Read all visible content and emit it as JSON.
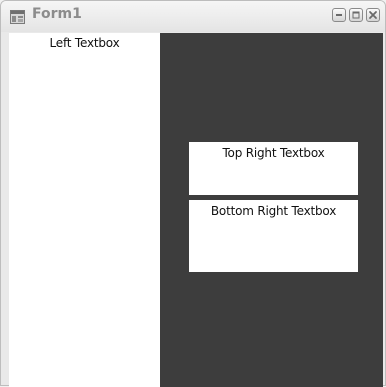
{
  "window": {
    "title": "Form1",
    "icon": "windows-form-icon",
    "controls": [
      "minimize-icon",
      "maximize-icon",
      "close-icon"
    ]
  },
  "textboxes": {
    "left": "Left Textbox",
    "top_right": "Top Right Textbox",
    "bottom_right": "Bottom Right Textbox"
  },
  "colors": {
    "client_background": "#3d3d3d",
    "textbox_background": "#ffffff"
  }
}
